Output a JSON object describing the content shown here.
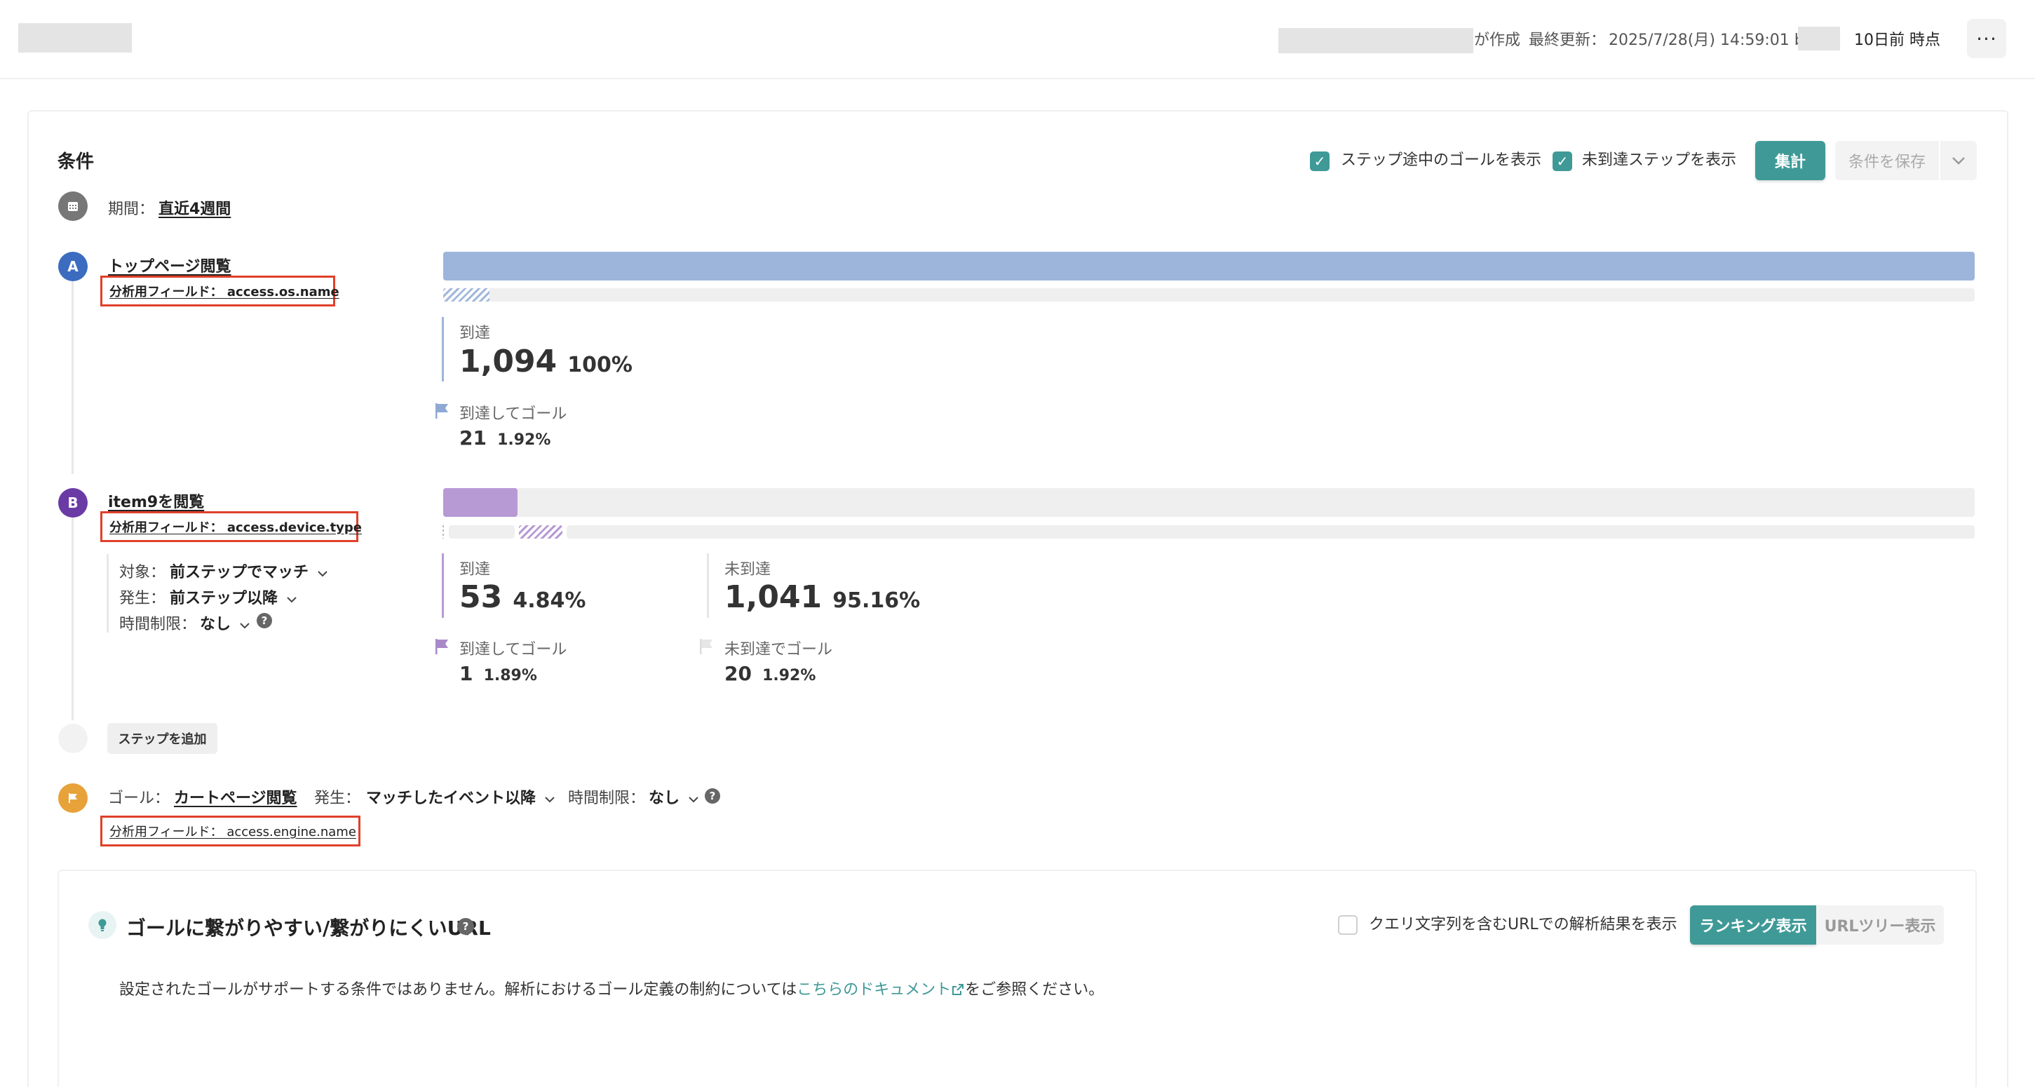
{
  "header": {
    "created_suffix": "が作成",
    "last_updated_label": "最終更新：",
    "last_updated_value": "2025/7/28(月) 14:59:01 by",
    "relative_time": "10日前 時点",
    "more_label": "···"
  },
  "conditions": {
    "title": "条件",
    "show_goal_midway": {
      "label": "ステップ途中のゴールを表示",
      "checked": true
    },
    "show_unreached": {
      "label": "未到達ステップを表示",
      "checked": true
    },
    "aggregate_button": "集計",
    "save_button": "条件を保存",
    "period_label": "期間：",
    "period_value": "直近4週間"
  },
  "steps": [
    {
      "letter": "A",
      "color": "#3b6cbf",
      "name": "トップページ閲覧",
      "field": "分析用フィールド： access.os.name",
      "reached_label": "到達",
      "reached_count": "1,094",
      "reached_pct": "100%",
      "reached_fraction": 1.0,
      "goal_label": "到達してゴール",
      "goal_count": "21",
      "goal_pct": "1.92%"
    },
    {
      "letter": "B",
      "color": "#6a3aa5",
      "name": "item9を閲覧",
      "field": "分析用フィールド： access.device.type",
      "target_label": "対象：",
      "target_value": "前ステップでマッチ",
      "occurrence_label": "発生：",
      "occurrence_value": "前ステップ以降",
      "time_limit_label": "時間制限：",
      "time_limit_value": "なし",
      "reached_label": "到達",
      "reached_count": "53",
      "reached_pct": "4.84%",
      "reached_fraction": 0.0484,
      "unreached_label": "未到達",
      "unreached_count": "1,041",
      "unreached_pct": "95.16%",
      "goal_label": "到達してゴール",
      "goal_count": "1",
      "goal_pct": "1.89%",
      "unreached_goal_label": "未到達でゴール",
      "unreached_goal_count": "20",
      "unreached_goal_pct": "1.92%"
    }
  ],
  "add_step_button": "ステップを追加",
  "goal": {
    "label": "ゴール：",
    "name": "カートページ閲覧",
    "occurrence_label": "発生：",
    "occurrence_value": "マッチしたイベント以降",
    "time_limit_label": "時間制限：",
    "time_limit_value": "なし",
    "field": "分析用フィールド： access.engine.name"
  },
  "url_panel": {
    "title": "ゴールに繋がりやすい/繋がりにくいURL",
    "query_checkbox_label": "クエリ文字列を含むURLでの解析結果を表示",
    "query_checkbox_checked": false,
    "tab_ranking": "ランキング表示",
    "tab_tree": "URLツリー表示",
    "notice_before": "設定されたゴールがサポートする条件ではありません。解析におけるゴール定義の制約については",
    "notice_link": "こちらのドキュメント",
    "notice_after": "をご参照ください。"
  },
  "colors": {
    "accent": "#3f9a97",
    "step_a_bar": "#9db5db",
    "step_b_bar": "#b79ad4",
    "goal_marker": "#e8a23a",
    "highlight_border": "#e0402a"
  }
}
